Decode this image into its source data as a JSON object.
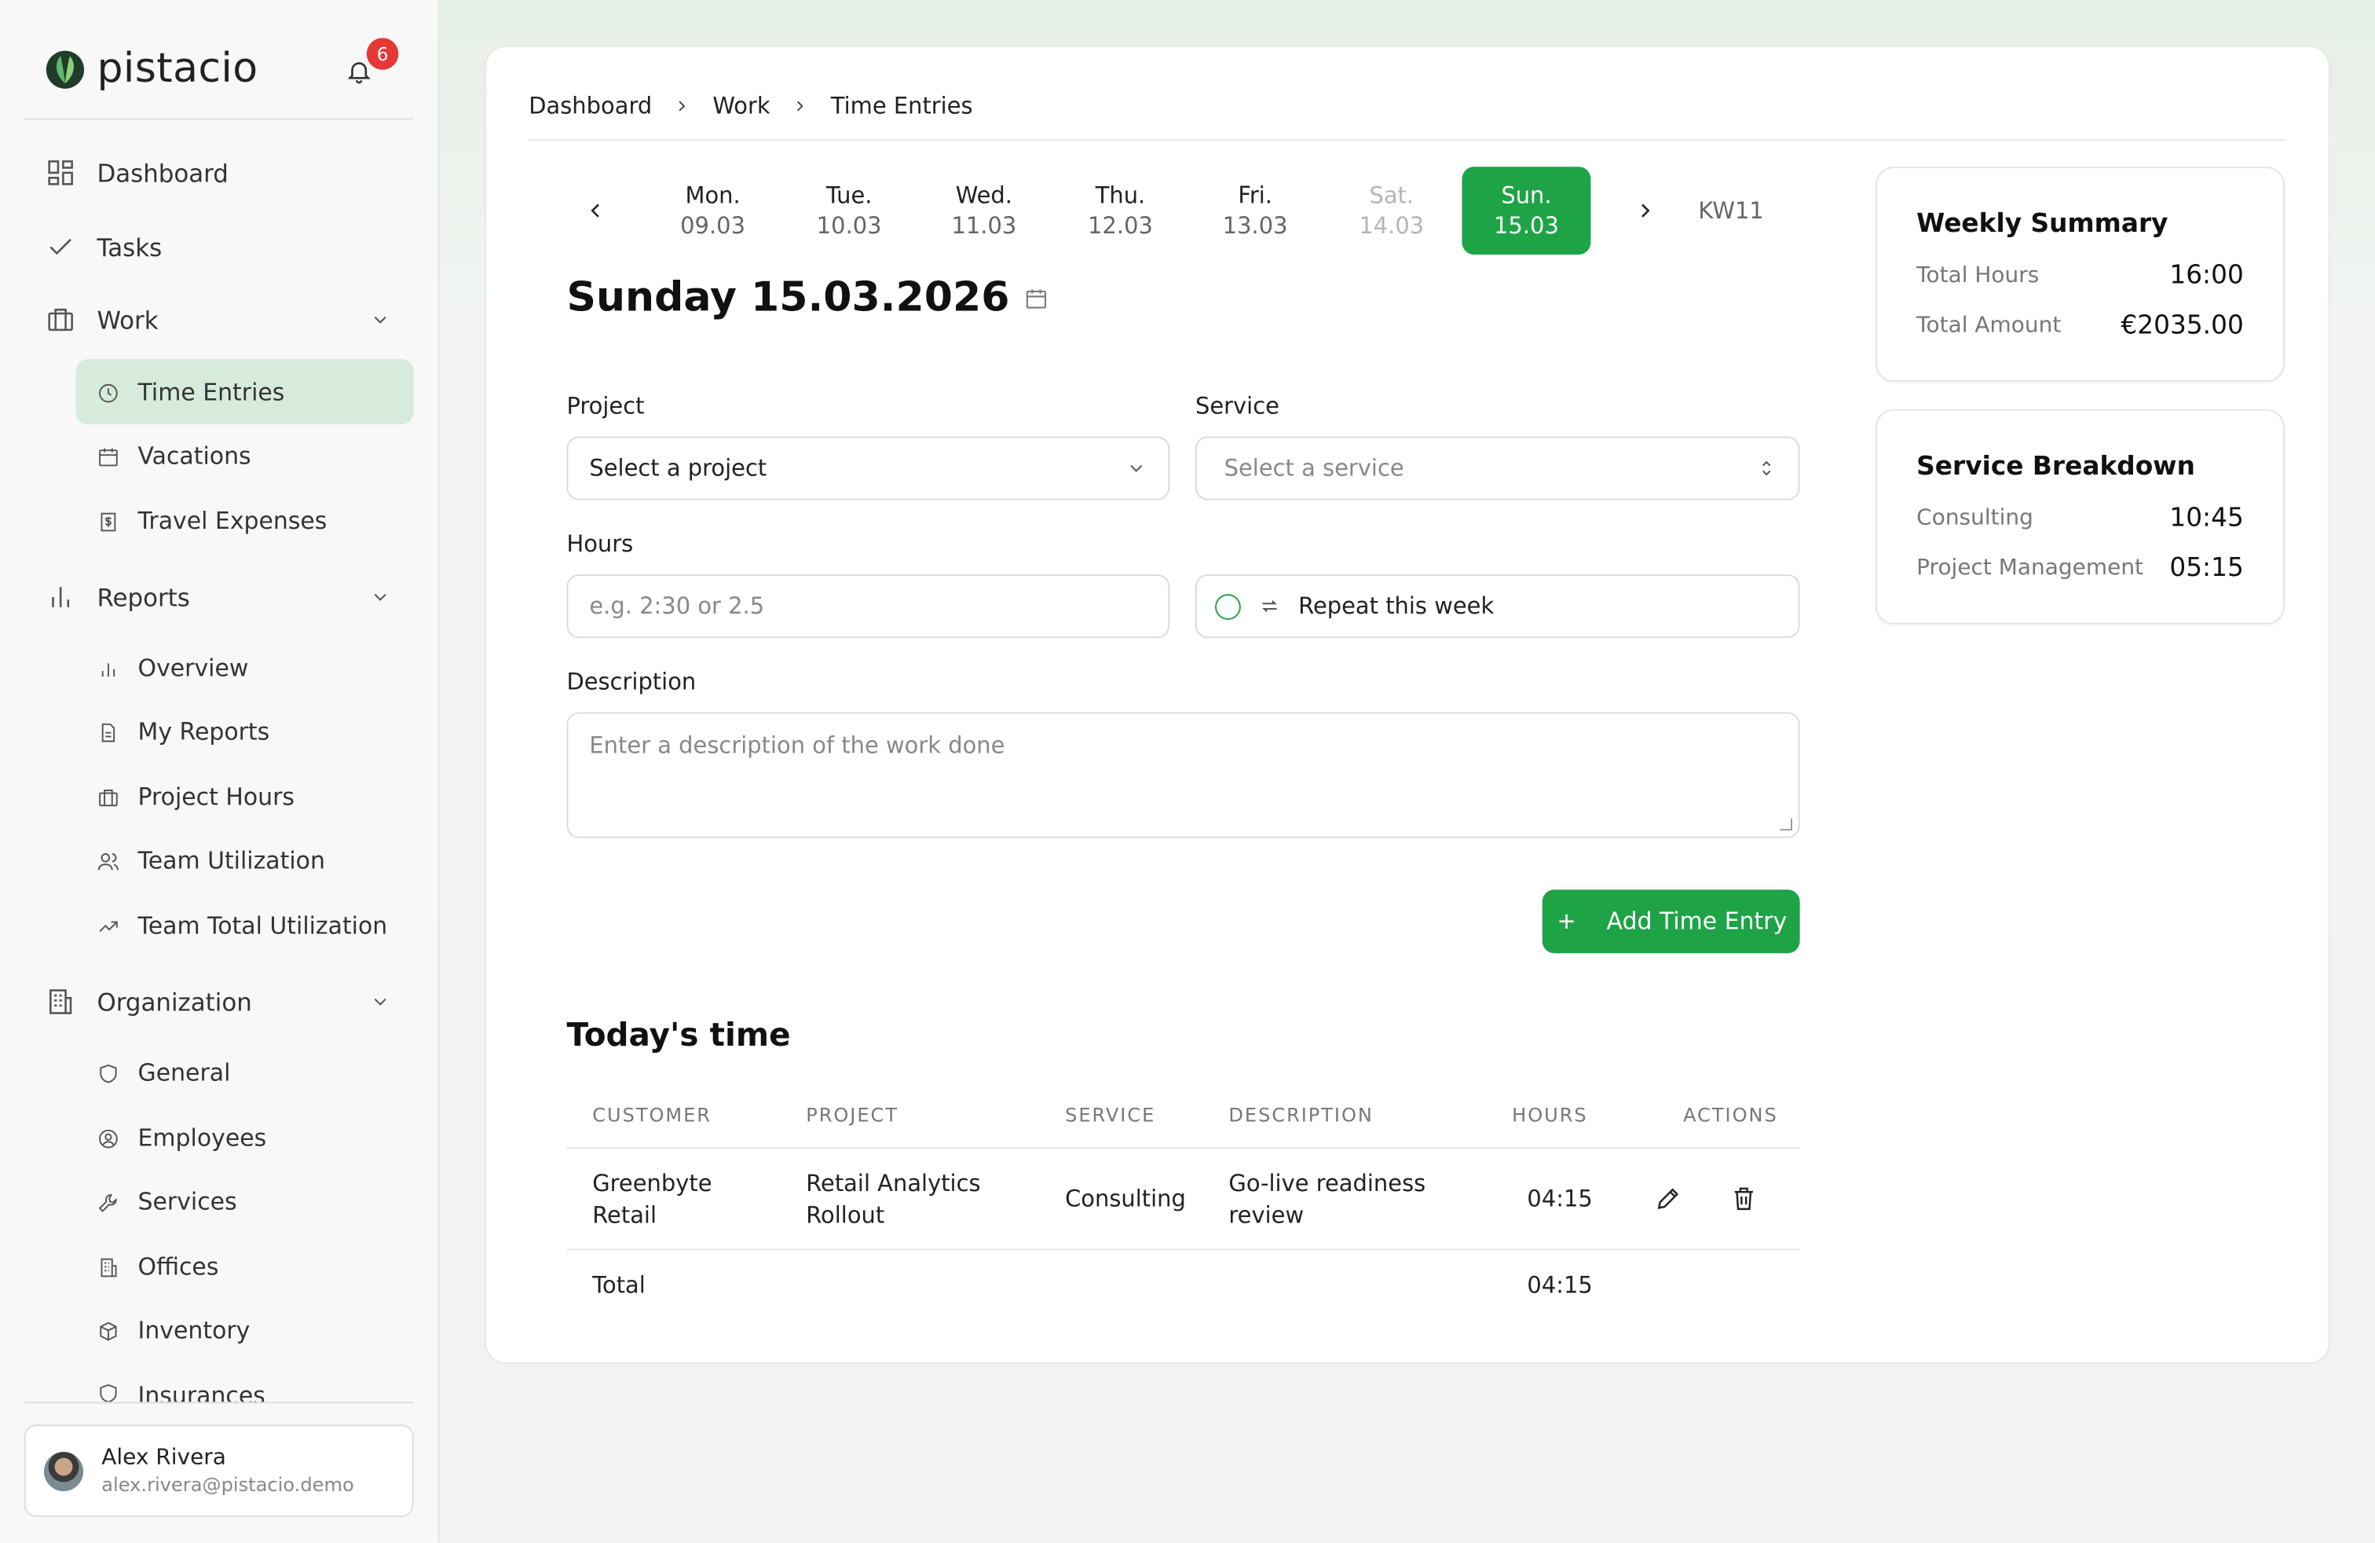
{
  "brand": {
    "name": "pistacio",
    "logo_icon": "pistachio-leaf-logo",
    "accent": "#1fa347"
  },
  "notifications": {
    "count": "6"
  },
  "sidebar": {
    "items": [
      {
        "label": "Dashboard",
        "icon": "grid-icon"
      },
      {
        "label": "Tasks",
        "icon": "check-icon"
      },
      {
        "label": "Work",
        "icon": "briefcase-icon"
      },
      {
        "label": "Reports",
        "icon": "bar-chart-icon"
      },
      {
        "label": "Organization",
        "icon": "building-icon"
      }
    ],
    "work_sub": [
      {
        "label": "Time Entries",
        "icon": "clock-icon"
      },
      {
        "label": "Vacations",
        "icon": "calendar-icon"
      },
      {
        "label": "Travel Expenses",
        "icon": "receipt-icon"
      }
    ],
    "reports_sub": [
      {
        "label": "Overview",
        "icon": "bar-chart-icon"
      },
      {
        "label": "My Reports",
        "icon": "document-icon"
      },
      {
        "label": "Project Hours",
        "icon": "briefcase-icon"
      },
      {
        "label": "Team Utilization",
        "icon": "users-icon"
      },
      {
        "label": "Team Total Utilization",
        "icon": "trend-up-icon"
      }
    ],
    "org_sub": [
      {
        "label": "General",
        "icon": "shield-icon"
      },
      {
        "label": "Employees",
        "icon": "user-circle-icon"
      },
      {
        "label": "Services",
        "icon": "wrench-icon"
      },
      {
        "label": "Offices",
        "icon": "office-icon"
      },
      {
        "label": "Inventory",
        "icon": "box-icon"
      },
      {
        "label": "Insurances",
        "icon": "shield-icon"
      }
    ]
  },
  "user": {
    "name": "Alex Rivera",
    "email": "alex.rivera@pistacio.demo"
  },
  "breadcrumb": [
    "Dashboard",
    "Work",
    "Time Entries"
  ],
  "week": {
    "days": [
      {
        "name": "Mon.",
        "date": "09.03"
      },
      {
        "name": "Tue.",
        "date": "10.03"
      },
      {
        "name": "Wed.",
        "date": "11.03"
      },
      {
        "name": "Thu.",
        "date": "12.03"
      },
      {
        "name": "Fri.",
        "date": "13.03"
      },
      {
        "name": "Sat.",
        "date": "14.03"
      },
      {
        "name": "Sun.",
        "date": "15.03"
      }
    ],
    "selected_day": "Sun.",
    "week_label": "KW11"
  },
  "form": {
    "date_title": "Sunday 15.03.2026",
    "project_label": "Project",
    "project_value": "Select a project",
    "service_label": "Service",
    "service_placeholder": "Select a service",
    "hours_label": "Hours",
    "hours_placeholder": "e.g. 2:30 or 2.5",
    "repeat_label": "Repeat this week",
    "description_label": "Description",
    "description_placeholder": "Enter a description of the work done",
    "submit_label": "Add Time Entry"
  },
  "today": {
    "title": "Today's time",
    "columns": [
      "CUSTOMER",
      "PROJECT",
      "SERVICE",
      "DESCRIPTION",
      "HOURS",
      "ACTIONS"
    ],
    "rows": [
      {
        "customer": "Greenbyte Retail",
        "project": "Retail Analytics Rollout",
        "service": "Consulting",
        "description": "Go-live readiness review",
        "hours": "04:15"
      }
    ],
    "total_label": "Total",
    "total_hours": "04:15"
  },
  "weekly_summary": {
    "title": "Weekly Summary",
    "total_hours_label": "Total Hours",
    "total_hours": "16:00",
    "total_amount_label": "Total Amount",
    "total_amount": "€2035.00"
  },
  "service_breakdown": {
    "title": "Service Breakdown",
    "items": [
      {
        "label": "Consulting",
        "value": "10:45"
      },
      {
        "label": "Project Management",
        "value": "05:15"
      }
    ]
  }
}
